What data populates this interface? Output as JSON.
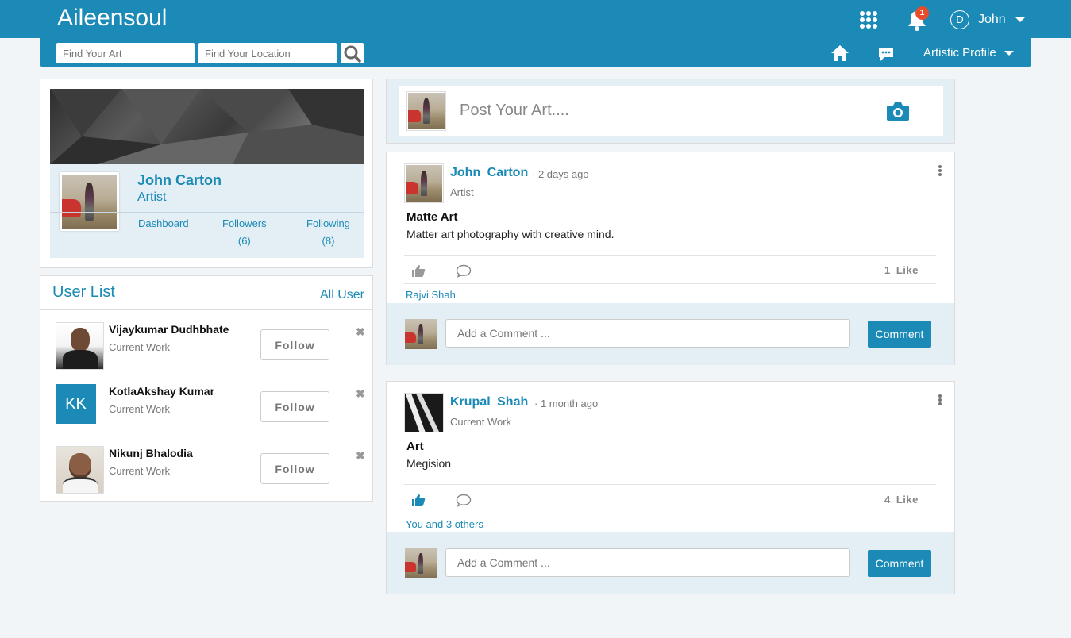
{
  "header": {
    "brand": "Aileensoul",
    "notification_count": "1",
    "user_initial": "D",
    "user_name": "John",
    "icons": [
      "apps-grid-icon",
      "bell-icon",
      "chevron-down-icon"
    ]
  },
  "subnav": {
    "search_art_placeholder": "Find Your Art",
    "search_location_placeholder": "Find Your Location",
    "profile_menu_label": "Artistic Profile",
    "icons": [
      "search-icon",
      "home-icon",
      "message-icon"
    ]
  },
  "profile": {
    "name": "John Carton",
    "role": "Artist",
    "dashboard_label": "Dashboard",
    "followers_label": "Followers",
    "followers_count": "(6)",
    "following_label": "Following",
    "following_count": "(8)"
  },
  "user_list": {
    "title": "User List",
    "all_link": "All User",
    "follow_label": "Follow",
    "users": [
      {
        "name": "Vijaykumar Dudhbhate",
        "subtitle": "Current Work"
      },
      {
        "name": "KotlaAkshay Kumar",
        "subtitle": "Current Work",
        "initials": "KK"
      },
      {
        "name": "Nikunj Bhalodia",
        "subtitle": "Current Work"
      }
    ]
  },
  "composer": {
    "placeholder": "Post Your Art...."
  },
  "posts": [
    {
      "author": "John Carton",
      "time": "· 2 days ago",
      "subtitle": "Artist",
      "title": "Matte Art",
      "body": "Matter art photography with creative mind.",
      "like_count": "1 Like",
      "liked": false,
      "likers": "Rajvi Shah",
      "comment_placeholder": "Add a Comment ...",
      "comment_button": "Comment"
    },
    {
      "author": "Krupal Shah",
      "time": "· 1 month ago",
      "subtitle": "Current Work",
      "title": "Art",
      "body": "Megision",
      "like_count": "4 Like",
      "liked": true,
      "likers": "You and 3 others",
      "comment_placeholder": "Add a Comment ...",
      "comment_button": "Comment"
    }
  ],
  "colors": {
    "brand": "#1b8ab6",
    "panel": "#e4eff5",
    "background": "#f1f5f8",
    "badge": "#e84c2b"
  }
}
